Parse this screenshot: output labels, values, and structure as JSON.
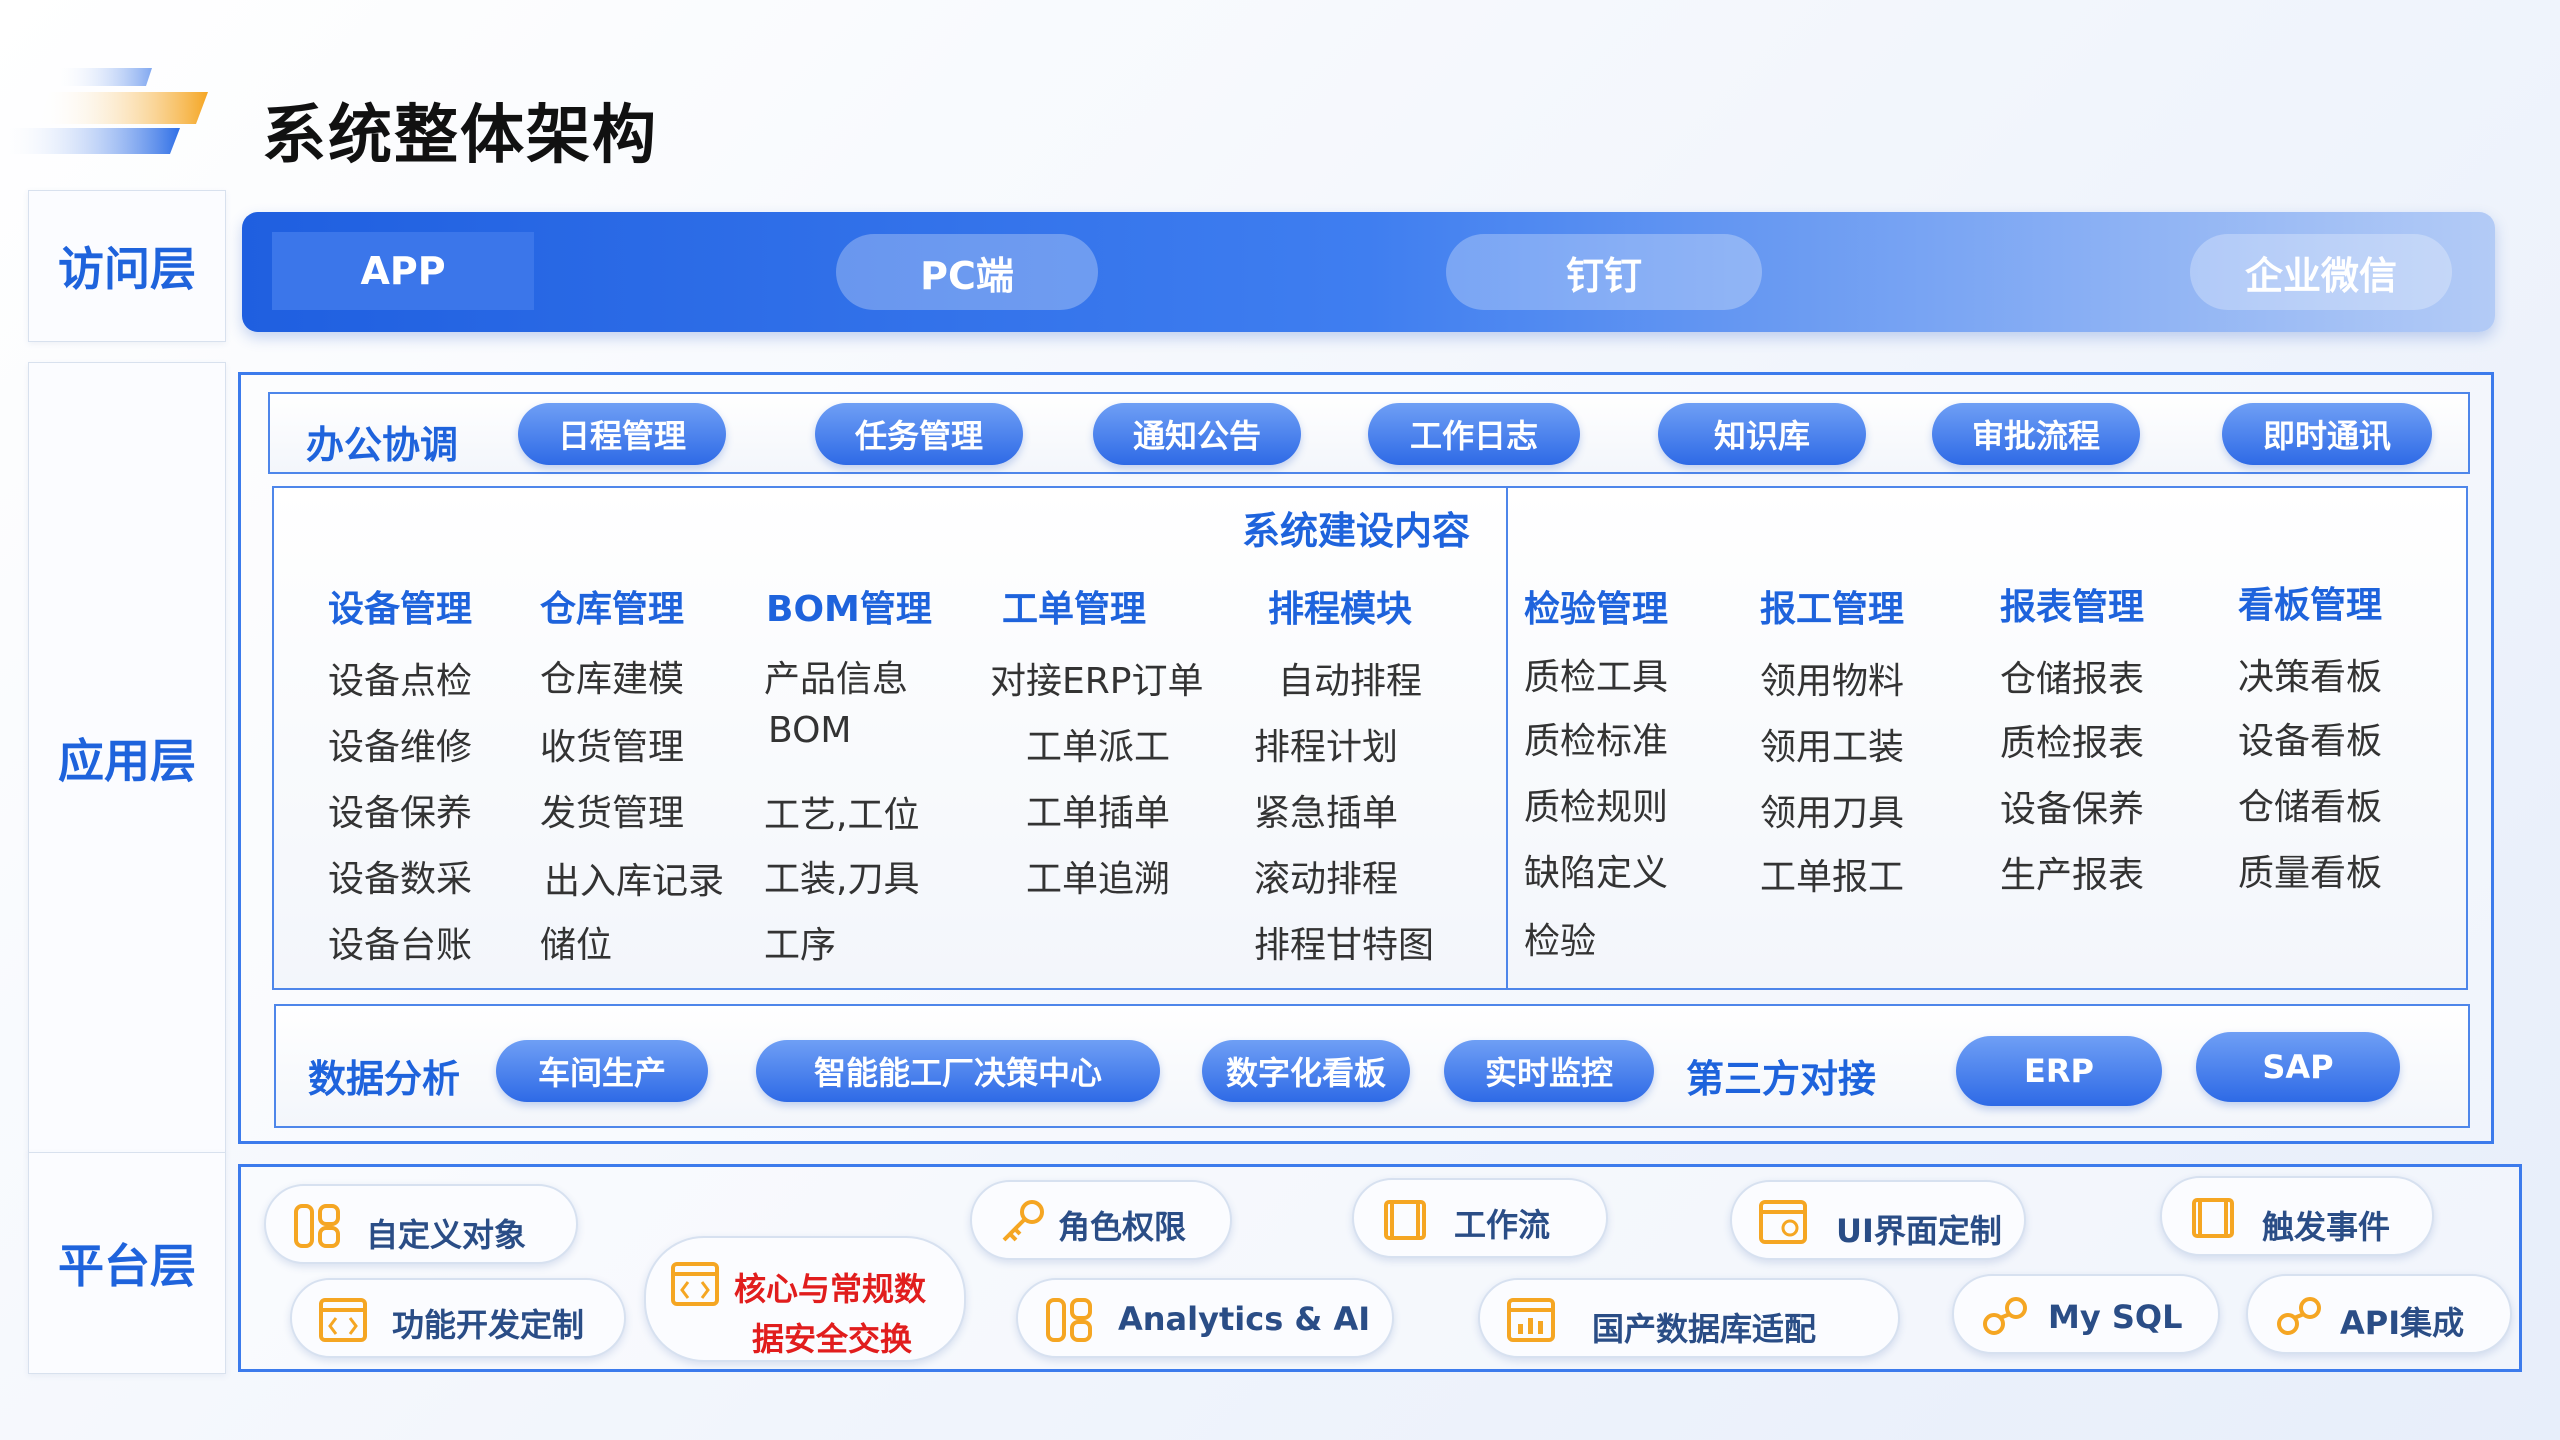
{
  "title": "系统整体架构",
  "layers": {
    "access": "访问层",
    "application": "应用层",
    "platform": "平台层"
  },
  "access_items": [
    "APP",
    "PC端",
    "钉钉",
    "企业微信"
  ],
  "office": {
    "title": "办公协调",
    "items": [
      "日程管理",
      "任务管理",
      "通知公告",
      "工作日志",
      "知识库",
      "审批流程",
      "即时通讯"
    ]
  },
  "construction": {
    "title": "系统建设内容",
    "columns": [
      {
        "head": "设备管理",
        "items": [
          "设备点检",
          "设备维修",
          "设备保养",
          "设备数采",
          "设备台账"
        ]
      },
      {
        "head": "仓库管理",
        "items": [
          "仓库建模",
          "收货管理",
          "发货管理",
          "出入库记录",
          "储位"
        ]
      },
      {
        "head": "BOM管理",
        "items": [
          "产品信息",
          "BOM",
          "工艺,工位",
          "工装,刀具",
          "工序"
        ]
      },
      {
        "head": "工单管理",
        "items": [
          "对接ERP订单",
          "工单派工",
          "工单插单",
          "工单追溯"
        ]
      },
      {
        "head": "排程模块",
        "items": [
          "自动排程",
          "排程计划",
          "紧急插单",
          "滚动排程",
          "排程甘特图"
        ]
      },
      {
        "head": "检验管理",
        "items": [
          "质检工具",
          "质检标准",
          "质检规则",
          "缺陷定义",
          "检验"
        ]
      },
      {
        "head": "报工管理",
        "items": [
          "领用物料",
          "领用工装",
          "领用刀具",
          "工单报工"
        ]
      },
      {
        "head": "报表管理",
        "items": [
          "仓储报表",
          "质检报表",
          "设备保养",
          "生产报表"
        ]
      },
      {
        "head": "看板管理",
        "items": [
          "决策看板",
          "设备看板",
          "仓储看板",
          "质量看板"
        ]
      }
    ]
  },
  "data_analysis": {
    "title": "数据分析",
    "items": [
      "车间生产",
      "智能能工厂决策中心",
      "数字化看板",
      "实时监控"
    ]
  },
  "third_party": {
    "title": "第三方对接",
    "items": [
      "ERP",
      "SAP"
    ]
  },
  "platform_items": [
    {
      "label": "自定义对象",
      "icon": "grid-icon"
    },
    {
      "label": "功能开发定制",
      "icon": "code-window-icon"
    },
    {
      "label": "核心与常规数",
      "label2": "据安全交换",
      "icon": "code-window-icon",
      "highlight": "#e11d1d"
    },
    {
      "label": "角色权限",
      "icon": "key-icon"
    },
    {
      "label": "Analytics & AI",
      "icon": "grid-icon"
    },
    {
      "label": "工作流",
      "icon": "scroll-icon"
    },
    {
      "label": "国产数据库适配",
      "icon": "chart-window-icon"
    },
    {
      "label": "UI界面定制",
      "icon": "browser-icon"
    },
    {
      "label": "My SQL",
      "icon": "link-icon"
    },
    {
      "label": "触发事件",
      "icon": "scroll-icon"
    },
    {
      "label": "API集成",
      "icon": "link-icon"
    }
  ],
  "colors": {
    "primary": "#1e63dc",
    "accent_orange": "#f5a623",
    "highlight_red": "#e11d1d"
  }
}
